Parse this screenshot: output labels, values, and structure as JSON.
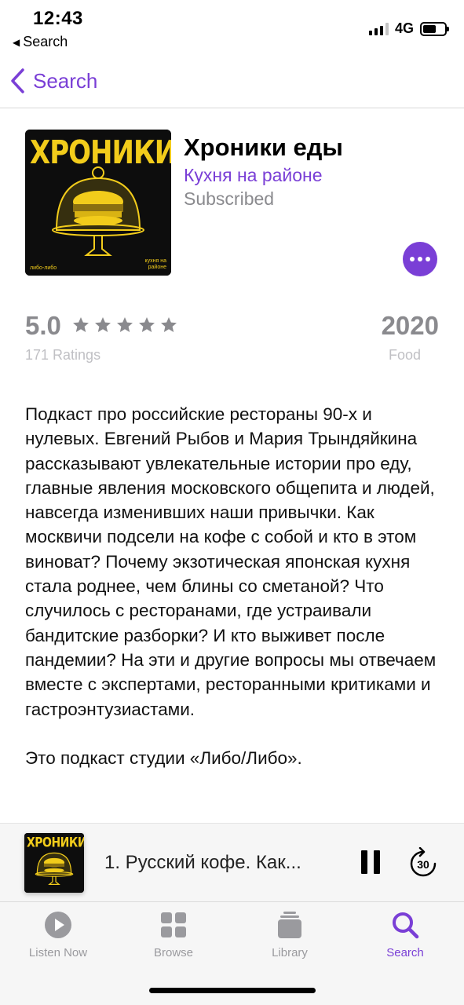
{
  "status_bar": {
    "time": "12:43",
    "back_app": "Search",
    "network": "4G"
  },
  "nav": {
    "back_label": "Search"
  },
  "podcast": {
    "artwork_title": "ХРОНИКИ ЕДЫ",
    "artwork_small_left": "либо-либо",
    "artwork_small_right": "кухня на районе",
    "title": "Хроники еды",
    "author": "Кухня на районе",
    "subscription_status": "Subscribed"
  },
  "ratings": {
    "average": "5.0",
    "stars": 5,
    "count": "171 Ratings",
    "year": "2020",
    "category": "Food"
  },
  "description": {
    "paragraph1": "Подкаст про российские рестораны 90-х и нулевых. Евгений Рыбов и Мария Трындяйкина рассказывают увлекательные истории про еду, главные явления московского общепита и людей, навсегда изменивших наши привычки. Как москвичи подсели на кофе с собой и кто в этом виноват? Почему экзотическая японская кухня стала роднее, чем блины со сметаной? Что случилось с ресторанами, где устраивали бандитские разборки? И кто выживет после пандемии? На эти и другие вопросы мы отвечаем вместе с экспертами, ресторанными критиками и гастроэнтузиастами.",
    "paragraph2": "Это подкаст студии «Либо/Либо»."
  },
  "mini_player": {
    "episode_title": "1. Русский кофе. Как...",
    "skip_seconds": "30"
  },
  "tabs": [
    {
      "label": "Listen Now",
      "icon": "play-circle-icon",
      "active": false
    },
    {
      "label": "Browse",
      "icon": "grid-icon",
      "active": false
    },
    {
      "label": "Library",
      "icon": "library-icon",
      "active": false
    },
    {
      "label": "Search",
      "icon": "search-icon",
      "active": true
    }
  ],
  "colors": {
    "accent": "#7a3fd6",
    "secondary_text": "#8a8a8e",
    "artwork_yellow": "#f2cc1b"
  }
}
